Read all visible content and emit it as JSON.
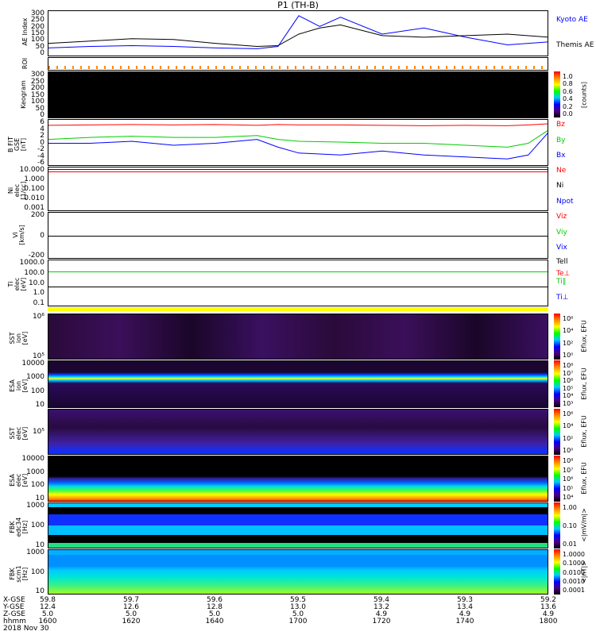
{
  "title": "P1 (TH-B)",
  "panels": {
    "ae": {
      "ylabel": "AE Index",
      "ticks": [
        "300",
        "250",
        "200",
        "150",
        "100",
        "50",
        "0"
      ],
      "legend": [
        "Kyoto AE",
        "Themis AE"
      ]
    },
    "roi": {
      "ylabel": "ROI"
    },
    "keo": {
      "ylabel": "Keogram",
      "ticks": [
        "300",
        "250",
        "200",
        "150",
        "100",
        "50",
        "0"
      ],
      "cbar": [
        "1.0",
        "0.8",
        "0.6",
        "0.4",
        "0.2",
        "0.0"
      ],
      "cunit": "[counts]"
    },
    "b": {
      "ylabel": "B FIT\nGSE\n[nT]",
      "ticks": [
        "6",
        "4",
        "2",
        "0",
        "-2",
        "-4",
        "-6"
      ],
      "legend": [
        "Bz",
        "By",
        "Bx"
      ]
    },
    "n": {
      "ylabel": "Ni\nelec\n[1/cc]",
      "ticks": [
        "10.000",
        "1.000",
        "0.100",
        "0.010",
        "0.001"
      ],
      "legend": [
        "Ne",
        "Ni",
        "Npot"
      ]
    },
    "v": {
      "ylabel": "Vi\n[km/s]",
      "ticks": [
        "200",
        "0",
        "-200"
      ],
      "legend": [
        "Viz",
        "Viy",
        "Vix"
      ]
    },
    "t": {
      "ylabel": "Ti\nelec\n[eV]",
      "ticks": [
        "1000.0",
        "100.0",
        "10.0",
        "1.0",
        "0.1"
      ],
      "legend": [
        "Tell",
        "Te⊥",
        "Ti∥",
        "Ti⊥"
      ]
    },
    "sst_i": {
      "ylabel": "SST\nion\n[eV]",
      "ticks": [
        "10⁶",
        "10⁵"
      ],
      "cbar": [
        "10⁶",
        "10⁴",
        "10²",
        "10⁰"
      ],
      "cunit": "Eflux, EFU"
    },
    "esa_i": {
      "ylabel": "ESA\nion\n[eV]",
      "ticks": [
        "10000",
        "1000",
        "100",
        "10"
      ],
      "cbar": [
        "10⁸",
        "10⁷",
        "10⁶",
        "10⁵",
        "10⁴",
        "10³"
      ],
      "cunit": "Eflux, EFU"
    },
    "sst_e": {
      "ylabel": "SST\nelec\n[eV]",
      "ticks": [
        "10⁵"
      ],
      "cbar": [
        "10⁶",
        "10⁴",
        "10²",
        "10⁰"
      ],
      "cunit": "Eflux, EFU"
    },
    "esa_e": {
      "ylabel": "ESA\nelec\n[eV]",
      "ticks": [
        "10000",
        "1000",
        "100",
        "10"
      ],
      "cbar": [
        "10⁸",
        "10⁷",
        "10⁶",
        "10⁵",
        "10⁴"
      ],
      "cunit": "Eflux, EFU"
    },
    "fbk1": {
      "ylabel": "FBK\nedc34\n[Hz]",
      "ticks": [
        "1000",
        "100",
        "10"
      ],
      "cbar": [
        "1.00",
        "0.10",
        "0.01"
      ],
      "cunit": "<|mV/m|>"
    },
    "fbk2": {
      "ylabel": "FBK\nscm1\n[Hz]",
      "ticks": [
        "1000",
        "100",
        "10"
      ],
      "cbar": [
        "1.0000",
        "0.1000",
        "0.0100",
        "0.0010",
        "0.0001"
      ],
      "cunit": "<|nT|>"
    }
  },
  "xaxis": {
    "row_labels": [
      "X-GSE",
      "Y-GSE",
      "Z-GSE",
      "hhmm",
      "2018 Nov 30"
    ],
    "cols": [
      {
        "x": "59.8",
        "y": "12.4",
        "z": "5.0",
        "t": "1600"
      },
      {
        "x": "59.7",
        "y": "12.6",
        "z": "5.0",
        "t": "1620"
      },
      {
        "x": "59.6",
        "y": "12.8",
        "z": "5.0",
        "t": "1640"
      },
      {
        "x": "59.5",
        "y": "13.0",
        "z": "5.0",
        "t": "1700"
      },
      {
        "x": "59.4",
        "y": "13.2",
        "z": "4.9",
        "t": "1720"
      },
      {
        "x": "59.3",
        "y": "13.4",
        "z": "4.9",
        "t": "1740"
      },
      {
        "x": "59.2",
        "y": "13.6",
        "z": "4.9",
        "t": "1800"
      }
    ]
  },
  "chart_data": [
    {
      "type": "line",
      "title": "AE Index",
      "xlabel": "hhmm",
      "ylim": [
        0,
        300
      ],
      "x_min": [
        0,
        10,
        20,
        30,
        40,
        50,
        55,
        60,
        65,
        70,
        80,
        90,
        100,
        110,
        120
      ],
      "series": [
        {
          "name": "Kyoto AE",
          "color": "#0000ff",
          "values": [
            60,
            70,
            75,
            70,
            60,
            55,
            70,
            270,
            200,
            260,
            150,
            190,
            130,
            80,
            100
          ]
        },
        {
          "name": "Themis AE",
          "color": "#000000",
          "values": [
            90,
            105,
            120,
            115,
            90,
            70,
            75,
            150,
            190,
            210,
            140,
            130,
            140,
            150,
            130
          ]
        }
      ]
    },
    {
      "type": "line",
      "title": "B FIT GSE",
      "ylim": [
        -6,
        6
      ],
      "x_min": [
        0,
        10,
        20,
        30,
        40,
        50,
        55,
        60,
        70,
        80,
        90,
        100,
        110,
        115,
        120
      ],
      "series": [
        {
          "name": "Bz",
          "color": "#ff0000",
          "values": [
            4.6,
            4.7,
            4.8,
            4.7,
            4.8,
            4.6,
            4.8,
            4.7,
            4.7,
            4.6,
            4.5,
            4.6,
            4.5,
            4.7,
            5
          ]
        },
        {
          "name": "By",
          "color": "#00cc00",
          "values": [
            1,
            1.5,
            1.8,
            1.5,
            1.5,
            2,
            1,
            0.5,
            0.3,
            0,
            0,
            -0.5,
            -1,
            0,
            3.5
          ]
        },
        {
          "name": "Bx",
          "color": "#0000ff",
          "values": [
            0,
            0,
            0.5,
            -0.5,
            0,
            1,
            -1,
            -2.5,
            -3,
            -2,
            -3,
            -3.5,
            -4,
            -3,
            3
          ]
        }
      ]
    }
  ]
}
